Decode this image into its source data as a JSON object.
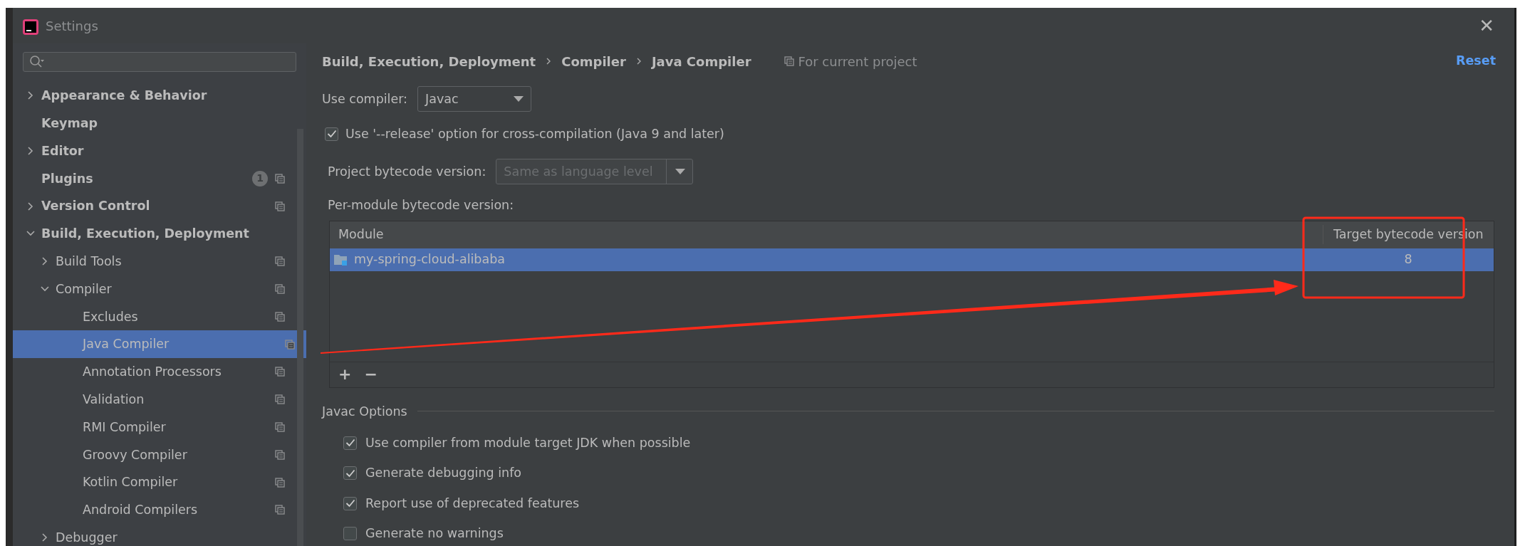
{
  "window": {
    "title": "Settings",
    "close": "✕"
  },
  "sidebar": {
    "items": [
      {
        "label": "Appearance & Behavior",
        "expanded": false,
        "has_children": true,
        "project_level": false,
        "selected": false
      },
      {
        "label": "Keymap",
        "has_children": false,
        "project_level": false,
        "selected": false
      },
      {
        "label": "Editor",
        "expanded": false,
        "has_children": true,
        "project_level": false,
        "selected": false
      },
      {
        "label": "Plugins",
        "has_children": false,
        "badge": "1",
        "project_level": true,
        "selected": false
      },
      {
        "label": "Version Control",
        "expanded": false,
        "has_children": true,
        "project_level": true,
        "selected": false
      },
      {
        "label": "Build, Execution, Deployment",
        "expanded": true,
        "has_children": true,
        "project_level": false,
        "selected": false,
        "children": [
          {
            "label": "Build Tools",
            "expanded": false,
            "has_children": true,
            "project_level": true,
            "selected": false
          },
          {
            "label": "Compiler",
            "expanded": true,
            "has_children": true,
            "project_level": true,
            "selected": false,
            "children": [
              {
                "label": "Excludes",
                "has_children": false,
                "project_level": true,
                "selected": false
              },
              {
                "label": "Java Compiler",
                "has_children": false,
                "project_level": true,
                "selected": true
              },
              {
                "label": "Annotation Processors",
                "has_children": false,
                "project_level": true,
                "selected": false
              },
              {
                "label": "Validation",
                "has_children": false,
                "project_level": true,
                "selected": false
              },
              {
                "label": "RMI Compiler",
                "has_children": false,
                "project_level": true,
                "selected": false
              },
              {
                "label": "Groovy Compiler",
                "has_children": false,
                "project_level": true,
                "selected": false
              },
              {
                "label": "Kotlin Compiler",
                "has_children": false,
                "project_level": true,
                "selected": false
              },
              {
                "label": "Android Compilers",
                "has_children": false,
                "project_level": true,
                "selected": false
              }
            ]
          },
          {
            "label": "Debugger",
            "expanded": false,
            "has_children": true,
            "project_level": false,
            "selected": false
          }
        ]
      }
    ]
  },
  "breadcrumb": [
    "Build, Execution, Deployment",
    "Compiler",
    "Java Compiler"
  ],
  "scope_note": "For current project",
  "reset": "Reset",
  "use_compiler": {
    "label": "Use compiler:",
    "value": "Javac"
  },
  "release_option": {
    "label": "Use '--release' option for cross-compilation (Java 9 and later)",
    "checked": true
  },
  "project_bytecode": {
    "label": "Project bytecode version:",
    "value": "Same as language level",
    "disabled": true
  },
  "per_module_label": "Per-module bytecode version:",
  "table": {
    "columns": [
      "Module",
      "Target bytecode version"
    ],
    "rows": [
      {
        "module": "my-spring-cloud-alibaba",
        "version": "8",
        "selected": true
      }
    ]
  },
  "table_toolbar": [
    "+",
    "−"
  ],
  "javac_options": {
    "title": "Javac Options",
    "options": [
      {
        "label": "Use compiler from module target JDK when possible",
        "checked": true
      },
      {
        "label": "Generate debugging info",
        "checked": true
      },
      {
        "label": "Report use of deprecated features",
        "checked": true
      },
      {
        "label": "Generate no warnings",
        "checked": false
      }
    ]
  },
  "annotations": {
    "highlight_box": true,
    "arrow": true
  }
}
